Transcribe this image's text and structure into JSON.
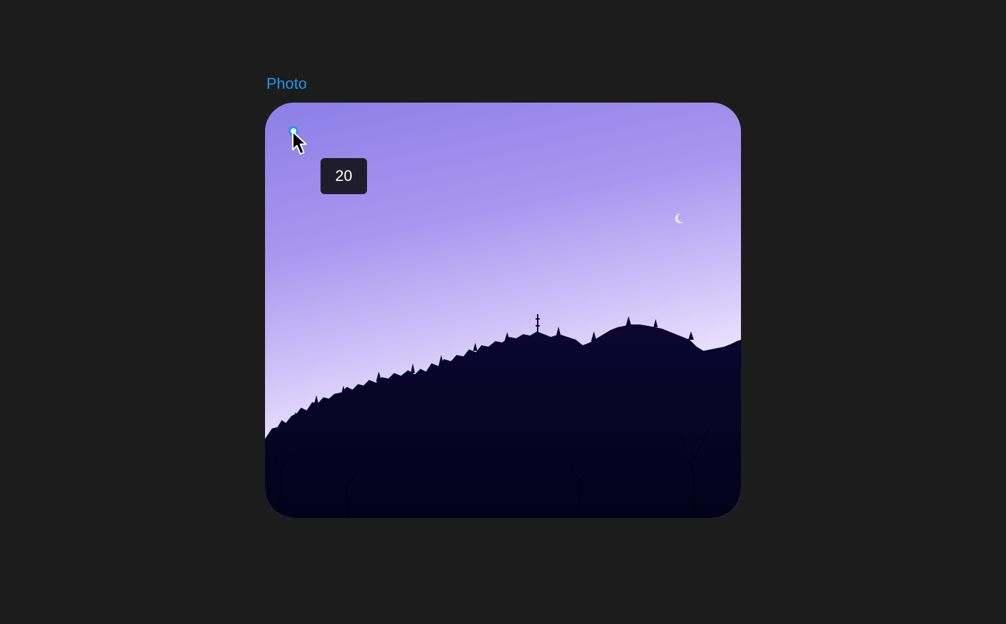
{
  "frame": {
    "label": "Photo"
  },
  "corner_radius_tooltip": {
    "value": "20"
  },
  "colors": {
    "label": "#1a9bf0",
    "handle_border": "#1a9bf0",
    "tooltip_bg": "#1f1d2b",
    "canvas_bg": "#1c1c1c"
  },
  "icons": {
    "handle": "corner-radius-handle-icon",
    "cursor": "mouse-pointer-icon"
  }
}
